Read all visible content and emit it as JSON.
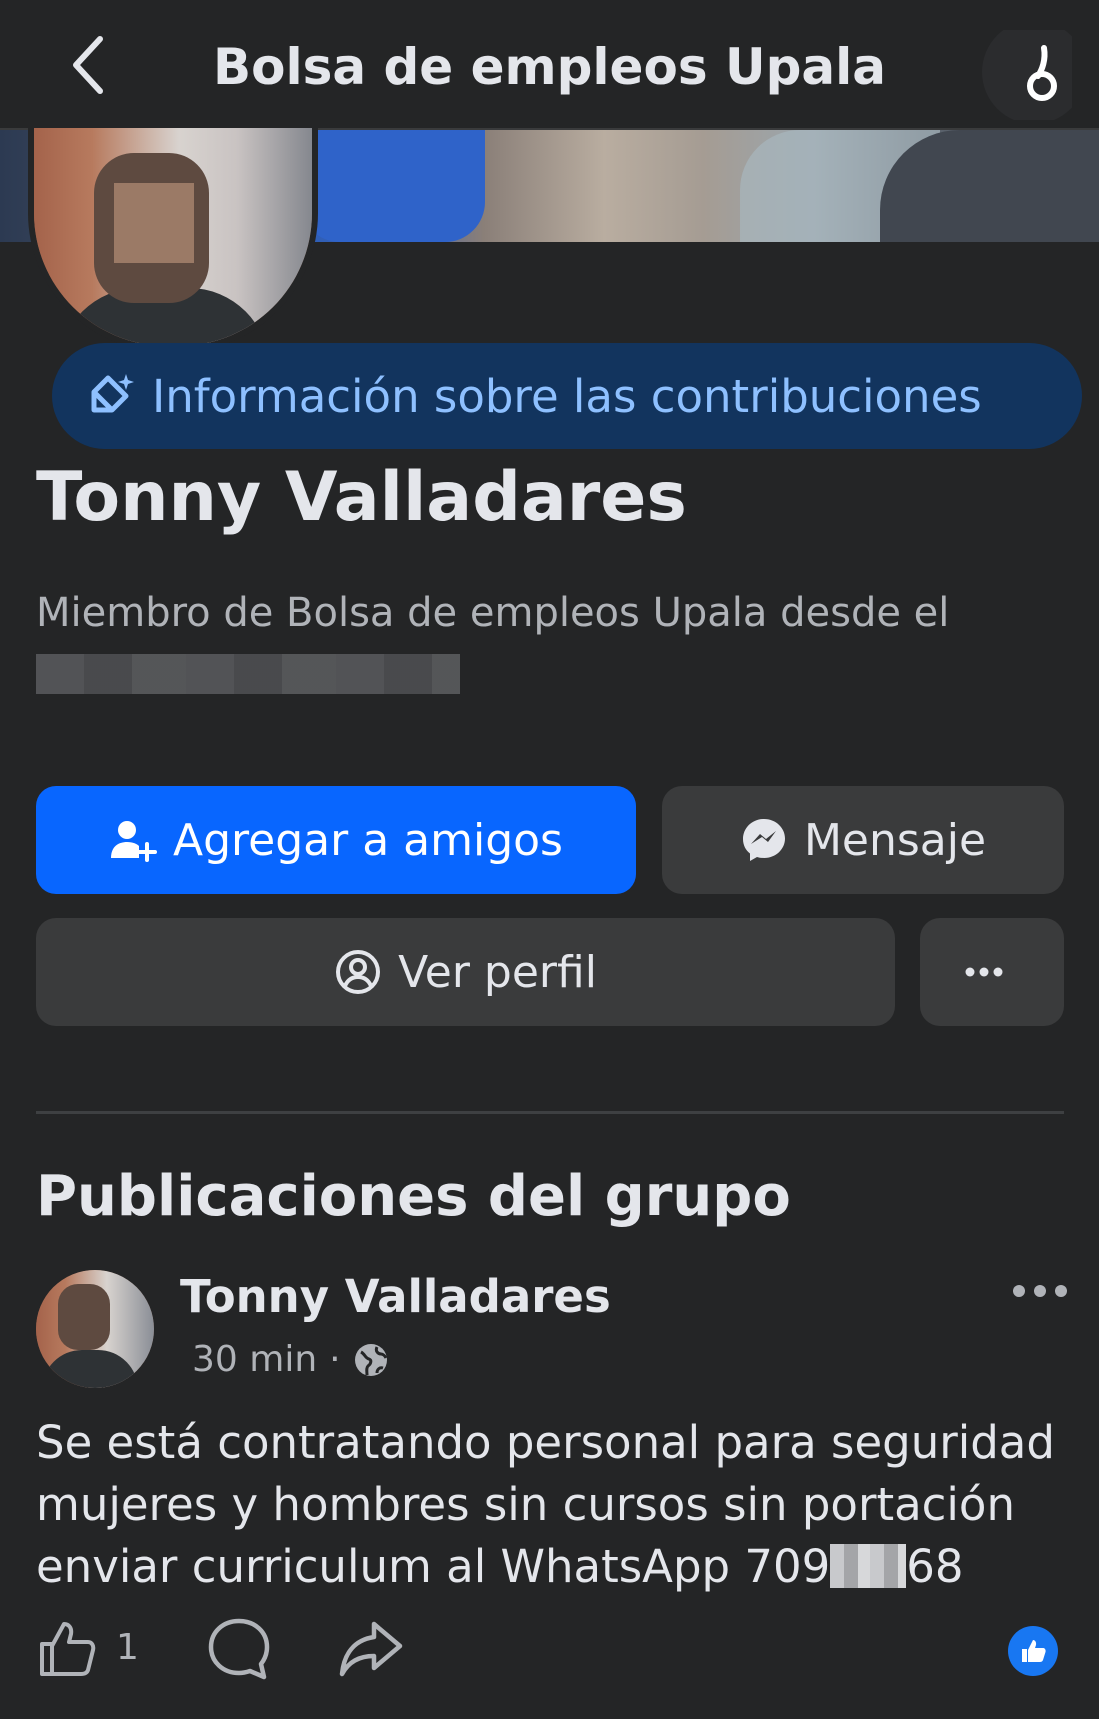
{
  "header": {
    "title": "Bolsa de empleos Upala"
  },
  "profile": {
    "contrib_label": "Información sobre las contribuciones",
    "name": "Tonny Valladares",
    "member_text": "Miembro de Bolsa de empleos Upala desde el"
  },
  "actions": {
    "add_friend": "Agregar a amigos",
    "message": "Mensaje",
    "view_profile": "Ver perfil",
    "more": "..."
  },
  "section": {
    "title": "Publicaciones del grupo"
  },
  "post": {
    "author": "Tonny Valladares",
    "time": "30 min",
    "separator": "·",
    "lines": [
      "Se está contratando personal para seguridad",
      "mujeres y hombres sin cursos sin portación"
    ],
    "line3_prefix": "enviar curriculum al WhatsApp 709",
    "line3_suffix": "68",
    "like_count": "1"
  },
  "colors": {
    "background": "#242526",
    "primary_button": "#0866ff",
    "secondary_button": "#3a3b3c",
    "contrib_pill": "#12345e",
    "contrib_text": "#8ec0ff"
  },
  "icons": {
    "back": "chevron-left-icon",
    "contrib": "badge-sparkle-icon",
    "add_friend": "add-person-icon",
    "message": "messenger-icon",
    "profile": "user-circle-icon",
    "privacy": "globe-icon",
    "like": "thumbs-up-icon",
    "comment": "comment-icon",
    "share": "share-icon"
  }
}
